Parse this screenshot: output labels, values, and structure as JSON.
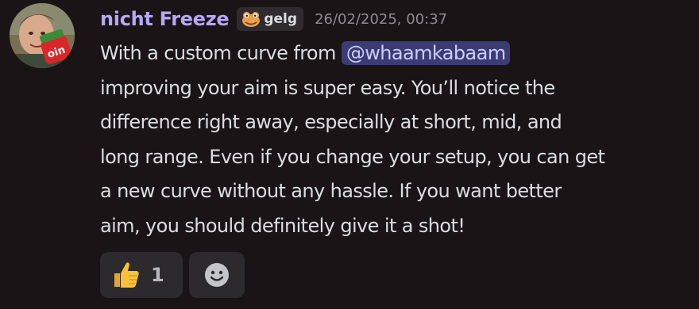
{
  "message": {
    "username": "nicht Freeze",
    "tag": {
      "label": "gelg",
      "icon": "frog-face-icon"
    },
    "timestamp": "26/02/2025, 00:37",
    "content": {
      "line1_prefix": "With a custom curve from ",
      "mention": "@whaamkabaam",
      "lines": [
        "improving your aim is super easy. You’ll notice the",
        "difference right away, especially at short, mid, and",
        "long range. Even if you change your setup, you can get",
        "a new curve without any hassle. If you want better",
        "aim, you should definitely give it a shot!"
      ]
    },
    "reactions": [
      {
        "emoji": "thumbs-up-icon",
        "count": "1"
      }
    ],
    "add_reaction_icon": "smiley-add-reaction-icon"
  },
  "colors": {
    "background": "#1a1416",
    "username": "#b6a8f5",
    "mention_bg": "#3c3c74",
    "mention_text": "#c9cdfb",
    "timestamp": "#8e8b90",
    "reaction_bg": "#2c2a2d"
  }
}
